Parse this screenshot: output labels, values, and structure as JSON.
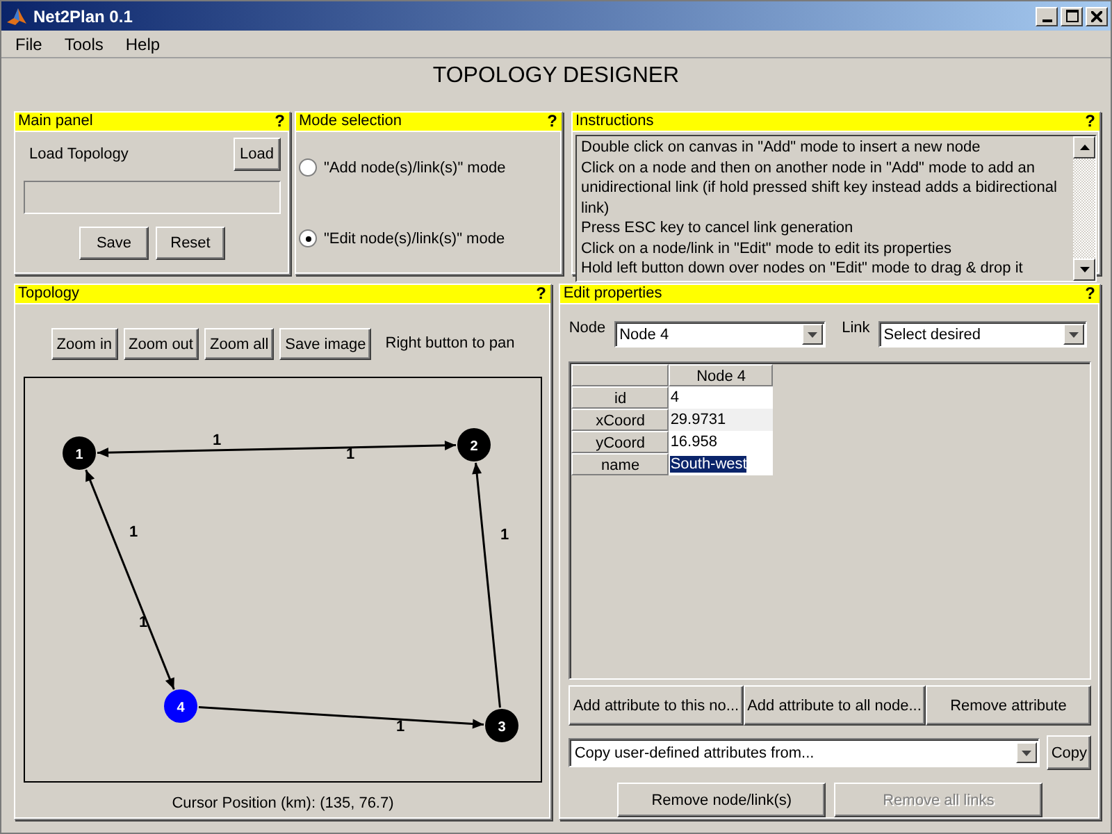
{
  "window": {
    "title": "Net2Plan 0.1"
  },
  "menu": [
    "File",
    "Tools",
    "Help"
  ],
  "heading": "TOPOLOGY DESIGNER",
  "main_panel": {
    "title": "Main panel",
    "help": "?",
    "load_label": "Load Topology",
    "load_button": "Load",
    "buttons": [
      "Save",
      "Reset"
    ]
  },
  "mode_selection": {
    "title": "Mode selection",
    "help": "?",
    "options": [
      {
        "label": "\"Add node(s)/link(s)\" mode",
        "selected": false
      },
      {
        "label": "\"Edit node(s)/link(s)\" mode",
        "selected": true
      }
    ]
  },
  "instructions": {
    "title": "Instructions",
    "help": "?",
    "lines": [
      "Double click on canvas in \"Add\" mode to insert a new node",
      "Click on a node and then on another node in \"Add\" mode to add an unidirectional link (if hold pressed shift key instead adds a bidirectional link)",
      "Press ESC key to cancel link generation",
      "Click on a node/link in \"Edit\" mode to edit its properties",
      "Hold left button down over nodes on \"Edit\" mode to drag & drop it"
    ]
  },
  "topology": {
    "title": "Topology",
    "help": "?",
    "buttons": [
      "Zoom in",
      "Zoom out",
      "Zoom all",
      "Save image"
    ],
    "hint": "Right button to pan",
    "nodes": [
      {
        "label": "1",
        "selected": false
      },
      {
        "label": "2",
        "selected": false
      },
      {
        "label": "3",
        "selected": false
      },
      {
        "label": "4",
        "selected": true
      }
    ],
    "links": [
      {
        "label": "1"
      },
      {
        "label": "1"
      },
      {
        "label": "1"
      },
      {
        "label": "1"
      },
      {
        "label": "1"
      },
      {
        "label": "1"
      }
    ],
    "cursor_position": "Cursor Position (km): (135, 76.7)"
  },
  "edit_properties": {
    "title": "Edit properties",
    "help": "?",
    "node_label": "Node",
    "node_value": "Node 4",
    "link_label": "Link",
    "link_value": "Select desired",
    "table": {
      "column": "Node 4",
      "rows": [
        {
          "key": "id",
          "value": "4",
          "selected": false
        },
        {
          "key": "xCoord",
          "value": "29.9731",
          "selected": false
        },
        {
          "key": "yCoord",
          "value": "16.958",
          "selected": false
        },
        {
          "key": "name",
          "value": "South-west",
          "selected": true
        }
      ]
    },
    "attribute_buttons": [
      "Add attribute to this no...",
      "Add attribute to all node...",
      "Remove attribute"
    ],
    "copy_from": "Copy user-defined attributes from...",
    "copy_button": "Copy",
    "bottom_buttons": [
      {
        "label": "Remove node/link(s)",
        "disabled": false
      },
      {
        "label": "Remove all links",
        "disabled": true
      }
    ]
  }
}
